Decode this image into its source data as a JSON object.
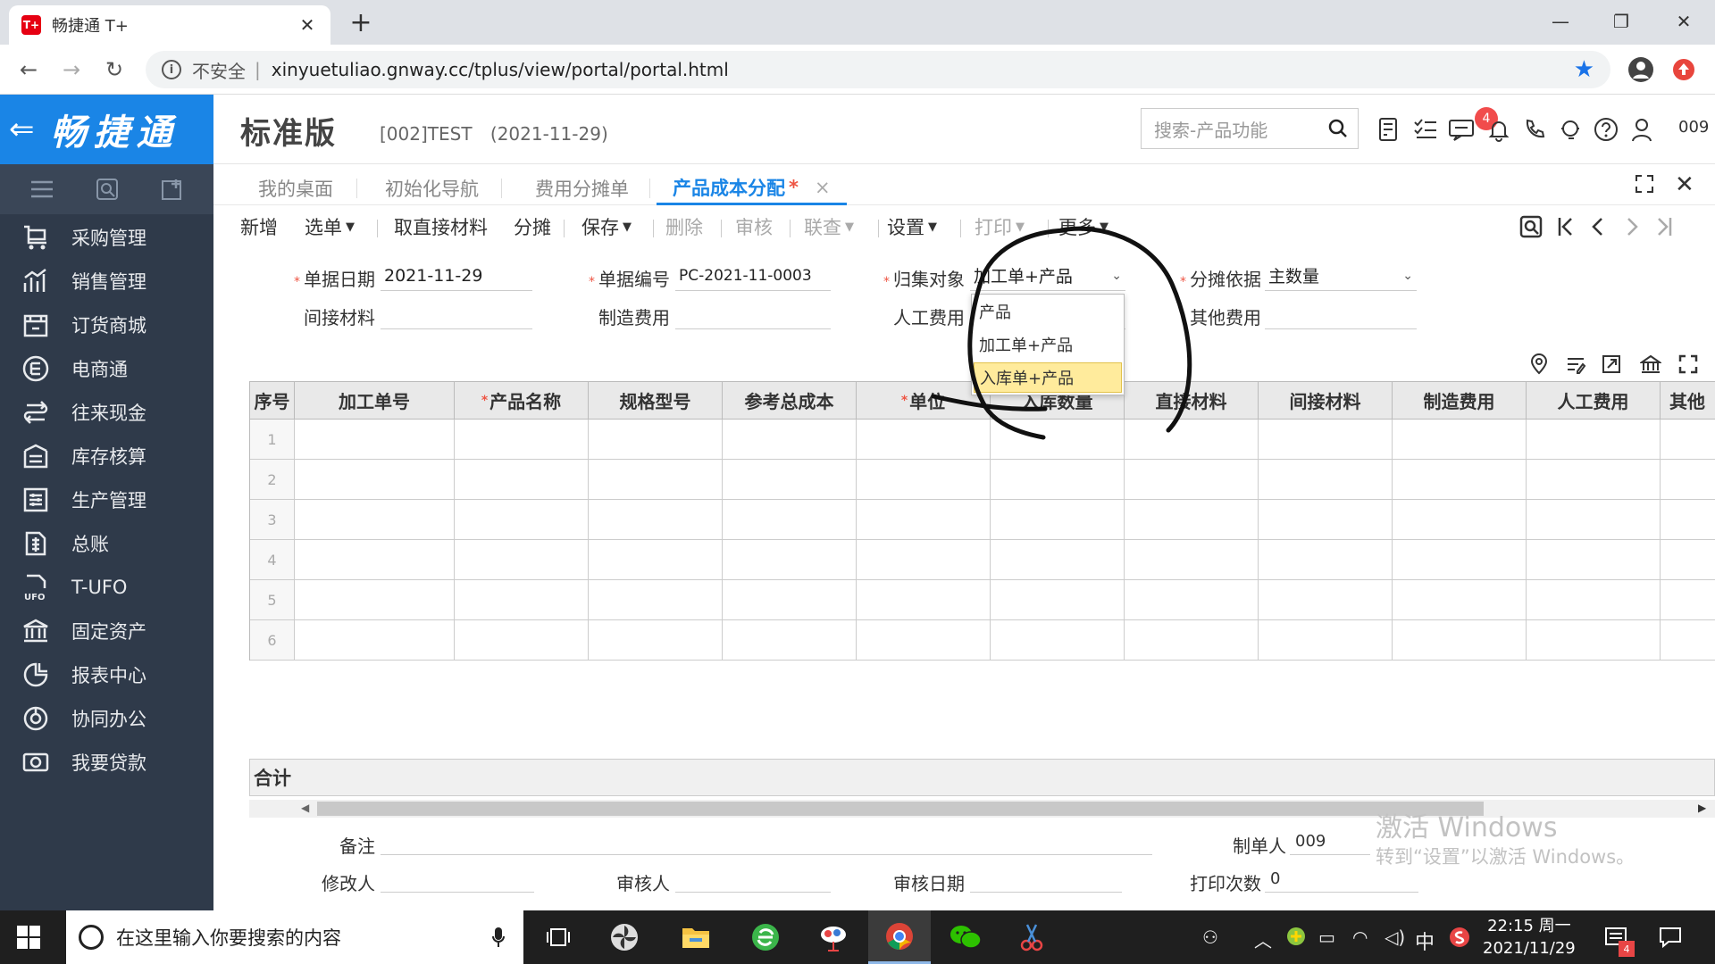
{
  "browser": {
    "tab_title": "畅捷通 T+",
    "tab_favicon_text": "T+",
    "security_label": "不安全",
    "url": "xinyuetuliao.gnway.cc/tplus/view/portal/portal.html"
  },
  "app": {
    "logo_text": "畅捷通",
    "edition": "标准版",
    "account": "[002]TEST",
    "date": "(2021-11-29)",
    "search_placeholder": "搜索-产品功能",
    "notification_count": "4",
    "user_id": "009"
  },
  "sidebar": {
    "items": [
      {
        "label": "采购管理",
        "icon": "purchase-icon"
      },
      {
        "label": "销售管理",
        "icon": "sales-chart-icon"
      },
      {
        "label": "订货商城",
        "icon": "store-icon"
      },
      {
        "label": "电商通",
        "icon": "ecommerce-icon"
      },
      {
        "label": "往来现金",
        "icon": "cash-icon"
      },
      {
        "label": "库存核算",
        "icon": "inventory-icon"
      },
      {
        "label": "生产管理",
        "icon": "production-icon"
      },
      {
        "label": "总账",
        "icon": "ledger-icon"
      },
      {
        "label": "T-UFO",
        "icon": "ufo-icon"
      },
      {
        "label": "固定资产",
        "icon": "asset-icon"
      },
      {
        "label": "报表中心",
        "icon": "report-icon"
      },
      {
        "label": "协同办公",
        "icon": "office-icon"
      },
      {
        "label": "我要贷款",
        "icon": "loan-icon"
      }
    ]
  },
  "tabs": [
    {
      "label": "我的桌面"
    },
    {
      "label": "初始化导航"
    },
    {
      "label": "费用分摊单"
    },
    {
      "label": "产品成本分配",
      "required_mark": "*",
      "close": "×"
    }
  ],
  "toolbar": {
    "new": "新增",
    "select": "选单",
    "fetch_direct": "取直接材料",
    "allocate": "分摊",
    "save": "保存",
    "delete": "删除",
    "audit": "审核",
    "link": "联查",
    "settings": "设置",
    "print": "打印",
    "more": "更多"
  },
  "form": {
    "req": "*",
    "doc_date_label": "单据日期",
    "doc_date": "2021-11-29",
    "doc_no_label": "单据编号",
    "doc_no": "PC-2021-11-0003",
    "collect_label": "归集对象",
    "collect_value": "加工单+产品",
    "basis_label": "分摊依据",
    "basis_value": "主数量",
    "indirect_label": "间接材料",
    "mfg_label": "制造费用",
    "labor_label": "人工费用",
    "other_label": "其他费用"
  },
  "dropdown": {
    "options": [
      "产品",
      "加工单+产品",
      "入库单+产品"
    ],
    "selected": "入库单+产品"
  },
  "grid": {
    "headers": [
      "序号",
      "加工单号",
      "产品名称",
      "规格型号",
      "参考总成本",
      "单位",
      "入库数量",
      "直接材料",
      "间接材料",
      "制造费用",
      "人工费用",
      "其他"
    ],
    "rows": [
      "1",
      "2",
      "3",
      "4",
      "5",
      "6"
    ],
    "total_label": "合计"
  },
  "footer": {
    "remark_label": "备注",
    "maker_label": "制单人",
    "maker_value": "009",
    "modifier_label": "修改人",
    "auditor_label": "审核人",
    "audit_date_label": "审核日期",
    "print_count_label": "打印次数",
    "print_count_value": "0"
  },
  "watermark": {
    "line1": "激活 Windows",
    "line2": "转到“设置”以激活 Windows。"
  },
  "taskbar": {
    "search_placeholder": "在这里输入你要搜索的内容",
    "ime": "中",
    "time": "22:15 周一",
    "date": "2021/11/29",
    "notif_count": "4"
  },
  "colors": {
    "brand_blue": "#1a85e6",
    "sidebar_bg": "#2f3a4a",
    "required_red": "#e54444",
    "annotation_ink": "#111111"
  }
}
